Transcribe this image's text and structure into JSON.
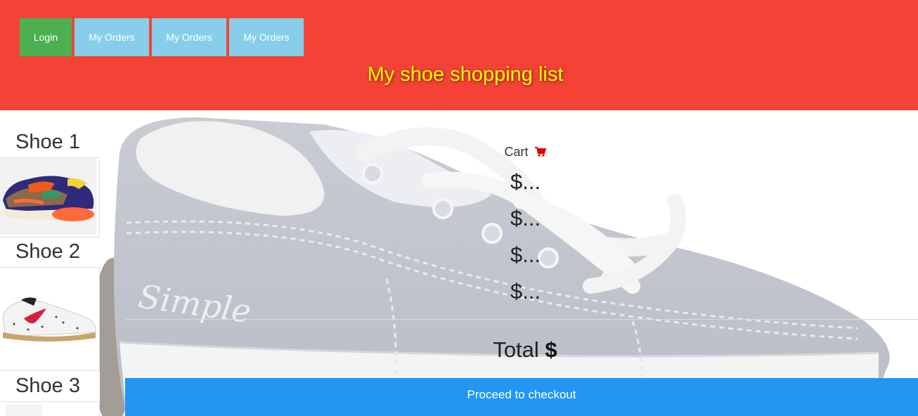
{
  "header": {
    "login_label": "Login",
    "nav": [
      "My Orders",
      "My Orders",
      "My Orders"
    ],
    "title": "My shoe shopping list"
  },
  "sidebar": {
    "shoes": [
      {
        "title": "Shoe 1"
      },
      {
        "title": "Shoe 2"
      },
      {
        "title": "Shoe 3"
      }
    ]
  },
  "background": {
    "brand_text": "Simple"
  },
  "cart": {
    "label": "Cart",
    "icon": "shopping-cart-icon",
    "prices": [
      "$...",
      "$...",
      "$...",
      "$..."
    ],
    "total_label": "Total",
    "total_value": "$"
  },
  "checkout": {
    "label": "Proceed to checkout"
  },
  "colors": {
    "header_bg": "#f44336",
    "login_bg": "#4caf50",
    "nav_bg": "#87ceeb",
    "title_color": "#ffff00",
    "checkout_bg": "#2196f3",
    "cart_icon": "#e00000"
  }
}
